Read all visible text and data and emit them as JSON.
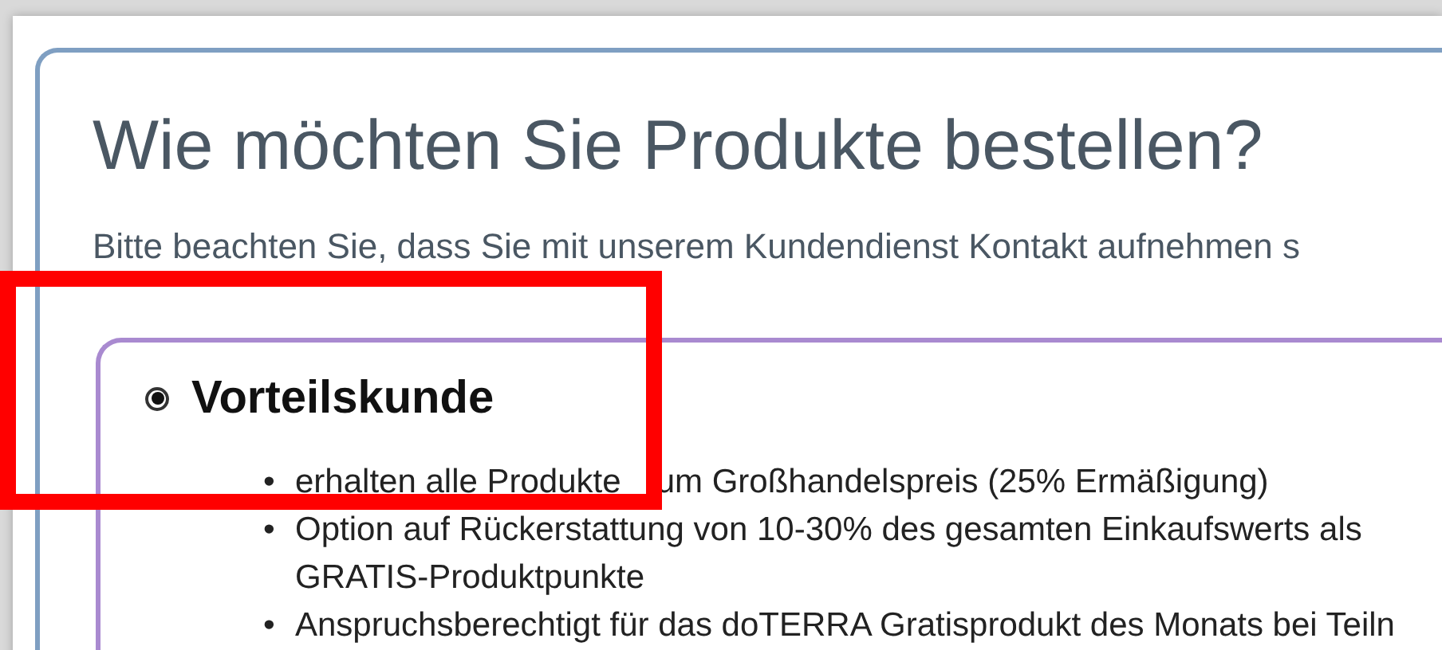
{
  "title": "Wie möchten Sie Produkte bestellen?",
  "notice": "Bitte beachten Sie, dass Sie mit unserem Kundendienst Kontakt aufnehmen s",
  "options": [
    {
      "label": "Vorteilskunde",
      "selected": true,
      "benefits": [
        {
          "marker": "•",
          "segments": [
            "erhalten alle Produkte",
            "um Großhandelspreis (25% Ermäßigung)"
          ]
        },
        {
          "marker": "•",
          "segments": [
            "Option auf Rückerstattung von 10-30% des gesamten Einkaufswerts als GRATIS-Produktpunkte"
          ]
        },
        {
          "marker": "•",
          "segments": [
            "Anspruchsberechtigt für das doTERRA Gratisprodukt des Monats bei Teiln"
          ]
        }
      ]
    }
  ],
  "highlight": {
    "color": "#ff0000"
  }
}
